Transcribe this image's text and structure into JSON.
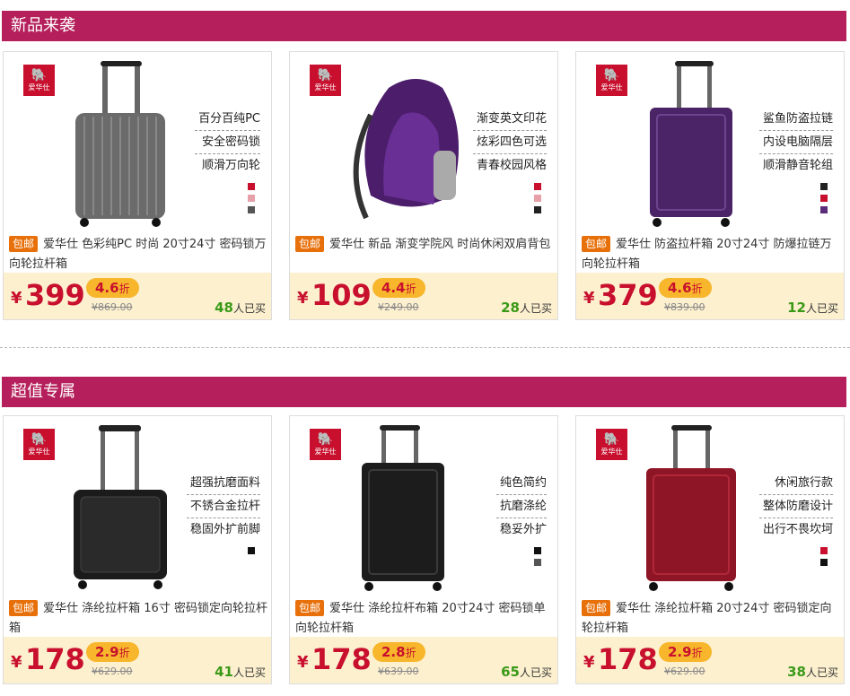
{
  "sections": [
    {
      "title": "新品来袭",
      "products": [
        {
          "features": [
            "百分百纯PC",
            "安全密码锁",
            "顺滑万向轮"
          ],
          "colors": [
            "#c8102e",
            "#e8a0a8",
            "#555555"
          ],
          "badge": "包邮",
          "title": "爱华仕 色彩纯PC 时尚 20寸24寸 密码锁万向轮拉杆箱",
          "yen": "¥",
          "price": "399",
          "discount": "4.6",
          "discount_unit": "折",
          "original": "¥869.00",
          "sold_count": "48",
          "sold_label": "人已买",
          "image": "hardshell-suitcase-gray"
        },
        {
          "features": [
            "渐变英文印花",
            "炫彩四色可选",
            "青春校园风格"
          ],
          "colors": [
            "#c8102e",
            "#e8a0a8",
            "#222222"
          ],
          "badge": "包邮",
          "title": "爱华仕 新品 渐变学院风 时尚休闲双肩背包",
          "yen": "¥",
          "price": "109",
          "discount": "4.4",
          "discount_unit": "折",
          "original": "¥249.00",
          "sold_count": "28",
          "sold_label": "人已买",
          "image": "backpack-purple"
        },
        {
          "features": [
            "鲨鱼防盗拉链",
            "内设电脑隔层",
            "顺滑静音轮组"
          ],
          "colors": [
            "#222222",
            "#c8102e",
            "#5b2c7a"
          ],
          "badge": "包邮",
          "title": "爱华仕 防盗拉杆箱 20寸24寸 防爆拉链万向轮拉杆箱",
          "yen": "¥",
          "price": "379",
          "discount": "4.6",
          "discount_unit": "折",
          "original": "¥839.00",
          "sold_count": "12",
          "sold_label": "人已买",
          "image": "softshell-suitcase-purple"
        }
      ]
    },
    {
      "title": "超值专属",
      "products": [
        {
          "features": [
            "超强抗磨面料",
            "不锈合金拉杆",
            "稳固外扩前脚"
          ],
          "colors": [
            "#111111"
          ],
          "badge": "包邮",
          "title": "爱华仕 涤纶拉杆箱 16寸 密码锁定向轮拉杆箱",
          "yen": "¥",
          "price": "178",
          "discount": "2.9",
          "discount_unit": "折",
          "original": "¥629.00",
          "sold_count": "41",
          "sold_label": "人已买",
          "image": "trolley-case-black"
        },
        {
          "features": [
            "纯色简约",
            "抗磨涤纶",
            "稳妥外扩"
          ],
          "colors": [
            "#111111",
            "#555555"
          ],
          "badge": "包邮",
          "title": "爱华仕 涤纶拉杆布箱 20寸24寸 密码锁单向轮拉杆箱",
          "yen": "¥",
          "price": "178",
          "discount": "2.8",
          "discount_unit": "折",
          "original": "¥639.00",
          "sold_count": "65",
          "sold_label": "人已买",
          "image": "softshell-suitcase-black"
        },
        {
          "features": [
            "休闲旅行款",
            "整体防磨设计",
            "出行不畏坎坷"
          ],
          "colors": [
            "#c8102e",
            "#111111"
          ],
          "badge": "包邮",
          "title": "爱华仕 涤纶拉杆箱 20寸24寸 密码锁定向轮拉杆箱",
          "yen": "¥",
          "price": "178",
          "discount": "2.9",
          "discount_unit": "折",
          "original": "¥629.00",
          "sold_count": "38",
          "sold_label": "人已买",
          "image": "softshell-suitcase-red"
        }
      ]
    }
  ],
  "brand_logo": {
    "text": "OIWAS 爱华仕",
    "color": "#c8102e",
    "icon": "elephant-icon"
  },
  "accent_colors": {
    "section_bar": "#b5205c",
    "price": "#c8102e",
    "discount_tag": "#f7b62b",
    "sold_count": "#3a9a18",
    "badge": "#e8700a",
    "price_bar": "#fdf0cf"
  }
}
